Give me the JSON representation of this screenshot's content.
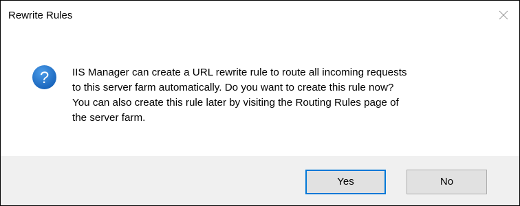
{
  "window": {
    "title": "Rewrite Rules",
    "close_icon": "close-icon"
  },
  "dialog": {
    "icon": "question-icon",
    "icon_glyph": "?",
    "message_lines": [
      "IIS Manager can create a URL rewrite rule to route all incoming requests",
      "to this server farm automatically. Do you want to create this rule now?",
      "You can also create this rule later by visiting the Routing Rules page of",
      "the server farm."
    ]
  },
  "buttons": {
    "yes_label": "Yes",
    "no_label": "No",
    "default": "yes"
  },
  "colors": {
    "icon_blue": "#1e6fc8",
    "footer_bg": "#f0f0f0",
    "button_bg": "#e1e1e1",
    "focus_border": "#0078d7"
  }
}
